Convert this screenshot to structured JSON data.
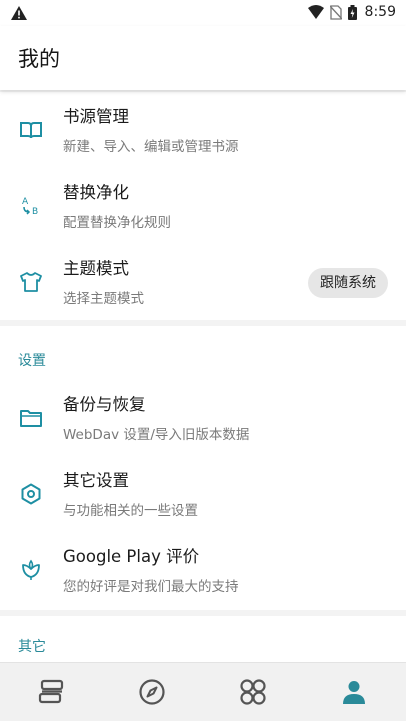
{
  "status_bar": {
    "time": "8:59"
  },
  "app_bar": {
    "title": "我的"
  },
  "section_main": {
    "items": [
      {
        "title": "书源管理",
        "subtitle": "新建、导入、编辑或管理书源"
      },
      {
        "title": "替换净化",
        "subtitle": "配置替换净化规则"
      },
      {
        "title": "主题模式",
        "subtitle": "选择主题模式",
        "chip": "跟随系统"
      }
    ]
  },
  "section_settings": {
    "header": "设置",
    "items": [
      {
        "title": "备份与恢复",
        "subtitle": "WebDav 设置/导入旧版本数据"
      },
      {
        "title": "其它设置",
        "subtitle": "与功能相关的一些设置"
      },
      {
        "title": "Google Play 评价",
        "subtitle": "您的好评是对我们最大的支持"
      }
    ]
  },
  "section_other": {
    "header": "其它"
  },
  "bottom_nav": {
    "items": [
      {
        "icon": "bookshelf-icon"
      },
      {
        "icon": "compass-icon"
      },
      {
        "icon": "rss-icon"
      },
      {
        "icon": "person-icon",
        "active": true
      }
    ]
  },
  "colors": {
    "accent": "#2a8a99",
    "icon_teal": "#1e8fa3",
    "nav_active": "#2a8a99",
    "nav_inactive": "#555555"
  }
}
